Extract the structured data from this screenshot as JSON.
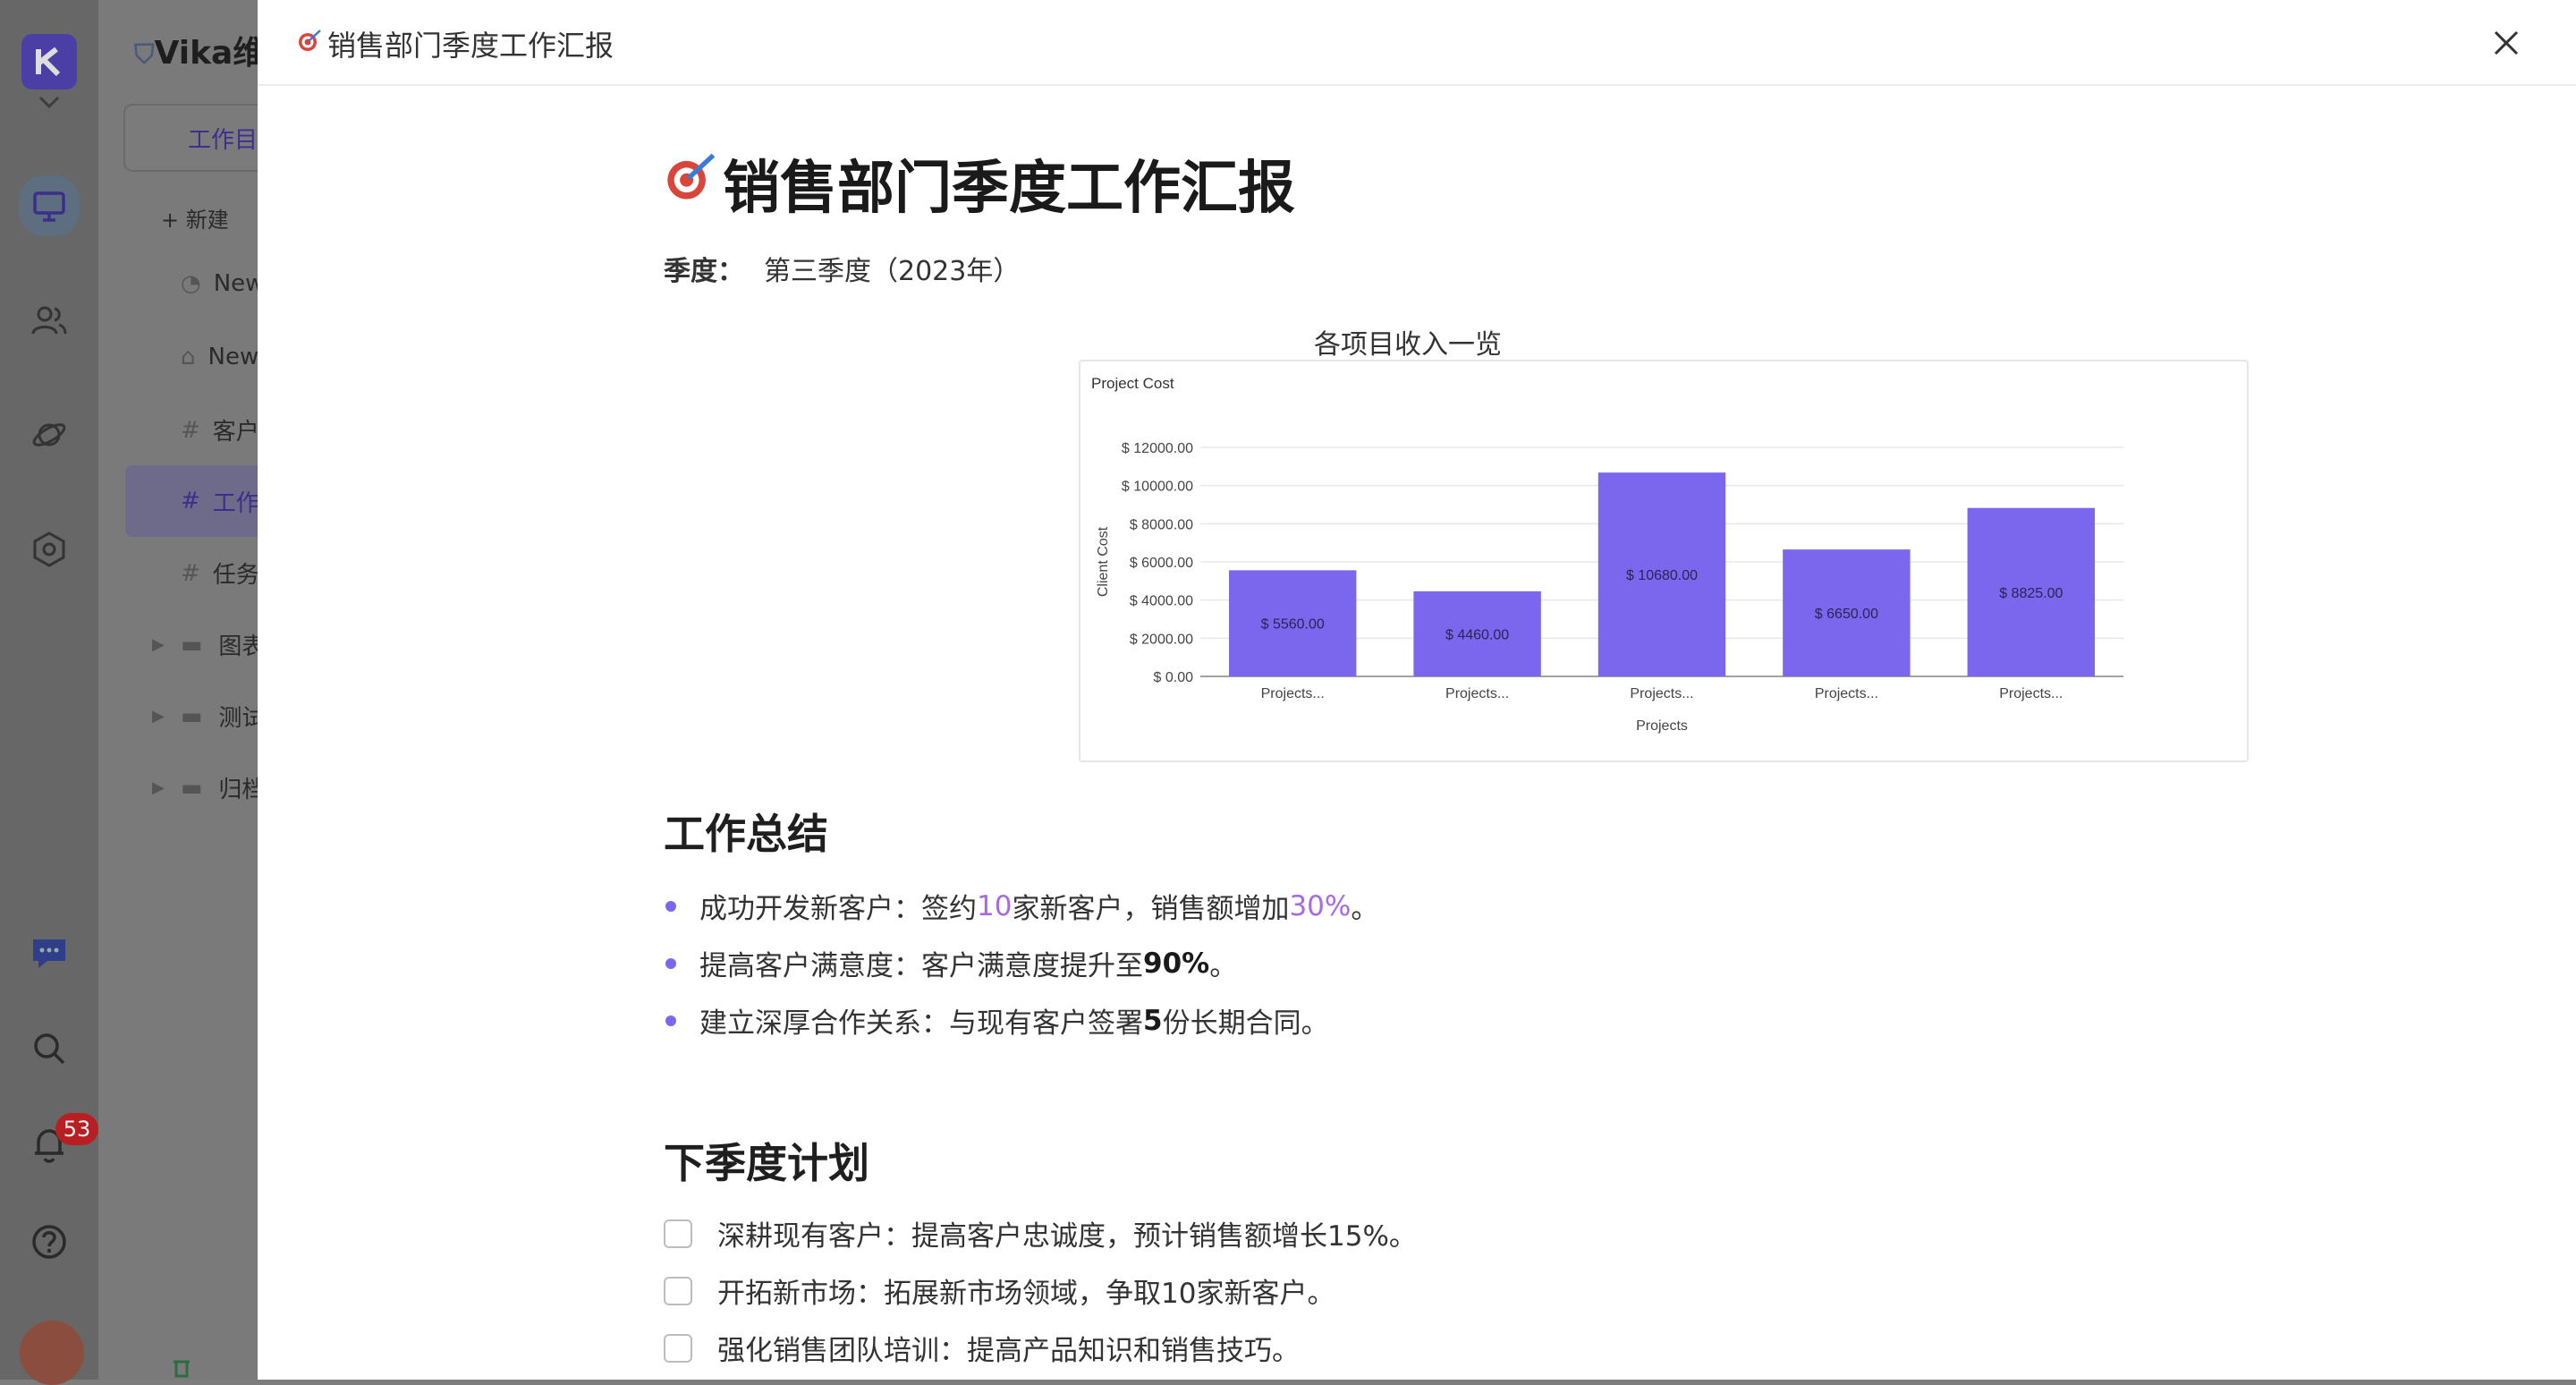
{
  "rail": {
    "notification_count": "53"
  },
  "tree": {
    "space_name": "Vika维",
    "tab_label": "工作目",
    "new_label": "+ 新建",
    "nodes": [
      {
        "label": "New",
        "icon": "dashboard-icon"
      },
      {
        "label": "New",
        "icon": "robot-icon"
      },
      {
        "label": "客户",
        "icon": "hash-icon"
      },
      {
        "label": "工作",
        "icon": "hash-icon",
        "selected": true
      },
      {
        "label": "任务",
        "icon": "hash-icon"
      }
    ],
    "folders": [
      {
        "label": "图表"
      },
      {
        "label": "测试"
      },
      {
        "label": "归档"
      }
    ]
  },
  "modal": {
    "header_title": "销售部门季度工作汇报",
    "close_icon": "close-icon"
  },
  "doc": {
    "title": "销售部门季度工作汇报",
    "meta_label": "季度：",
    "meta_value": "第三季度（2023年）",
    "chart_caption": "各项目收入一览",
    "summary_heading": "工作总结",
    "summary": [
      {
        "p1": "成功开发新客户：签约",
        "h1": "10",
        "p2": "家新客户，销售额增加",
        "h2": "30%",
        "p3": "。"
      },
      {
        "p1": "提高客户满意度：客户满意度提升至",
        "b": "90%",
        "p2": "。"
      },
      {
        "p1": "建立深厚合作关系：与现有客户签署",
        "b": "5",
        "p2": "份长期合同。"
      }
    ],
    "plan_heading": "下季度计划",
    "plan": [
      "深耕现有客户：提高客户忠诚度，预计销售额增长15%。",
      "开拓新市场：拓展新市场领域，争取10家新客户。",
      "强化销售团队培训：提高产品知识和销售技巧。"
    ]
  },
  "chart_data": {
    "type": "bar",
    "title": "Project Cost",
    "xlabel": "Projects",
    "ylabel": "Client Cost",
    "categories": [
      "Projects...",
      "Projects...",
      "Projects...",
      "Projects...",
      "Projects..."
    ],
    "values": [
      5560,
      4460,
      10680,
      6650,
      8825
    ],
    "value_labels": [
      "$ 5560.00",
      "$ 4460.00",
      "$ 10680.00",
      "$ 6650.00",
      "$ 8825.00"
    ],
    "yticks": [
      0,
      2000,
      4000,
      6000,
      8000,
      10000,
      12000
    ],
    "ytick_labels": [
      "$ 0.00",
      "$ 2000.00",
      "$ 4000.00",
      "$ 6000.00",
      "$ 8000.00",
      "$ 10000.00",
      "$ 12000.00"
    ],
    "ylim": [
      0,
      12000
    ],
    "grid": true,
    "bar_color": "#7b67ee"
  }
}
